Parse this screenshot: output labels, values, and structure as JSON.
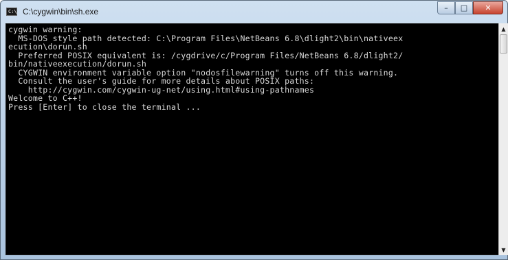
{
  "window": {
    "title": "C:\\cygwin\\bin\\sh.exe",
    "icon_name": "console-icon",
    "icon_glyph": "C:\\"
  },
  "controls": {
    "minimize": "–",
    "maximize": "□",
    "close": "✕"
  },
  "console": {
    "text": "cygwin warning:\n  MS-DOS style path detected: C:\\Program Files\\NetBeans 6.8\\dlight2\\bin\\nativeex\necution\\dorun.sh\n  Preferred POSIX equivalent is: /cygdrive/c/Program Files/NetBeans 6.8/dlight2/\nbin/nativeexecution/dorun.sh\n  CYGWIN environment variable option \"nodosfilewarning\" turns off this warning.\n  Consult the user's guide for more details about POSIX paths:\n    http://cygwin.com/cygwin-ug-net/using.html#using-pathnames\nWelcome to C++!\nPress [Enter] to close the terminal ..."
  },
  "scrollbar": {
    "up": "▲",
    "down": "▼"
  }
}
